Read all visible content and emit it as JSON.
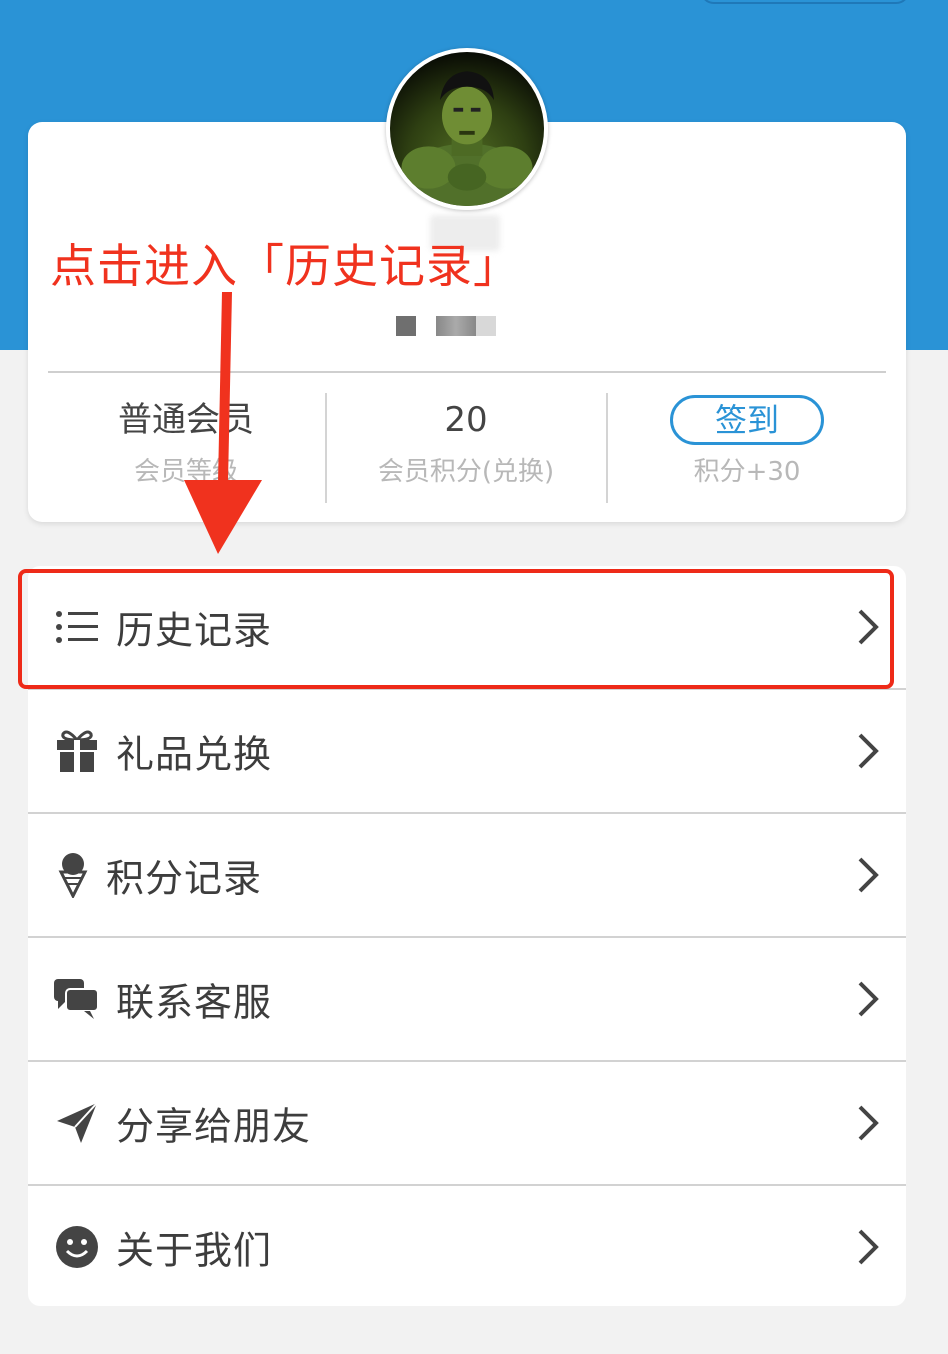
{
  "profile": {
    "stats": [
      {
        "value": "普通会员",
        "label": "会员等级"
      },
      {
        "value": "20",
        "label": "会员积分(兑换)"
      },
      {
        "value": "签到",
        "label": "积分+30"
      }
    ]
  },
  "menu": {
    "items": [
      {
        "label": "历史记录",
        "icon": "list-icon"
      },
      {
        "label": "礼品兑换",
        "icon": "gift-icon"
      },
      {
        "label": "积分记录",
        "icon": "ice-cream-icon"
      },
      {
        "label": "联系客服",
        "icon": "chat-bubbles-icon"
      },
      {
        "label": "分享给朋友",
        "icon": "paper-plane-icon"
      },
      {
        "label": "关于我们",
        "icon": "smiley-icon"
      }
    ]
  },
  "annotation": {
    "text": "点击进入「历史记录」",
    "color": "#f0321e"
  },
  "colors": {
    "brand_blue": "#2a93d6",
    "background": "#f2f2f2"
  }
}
